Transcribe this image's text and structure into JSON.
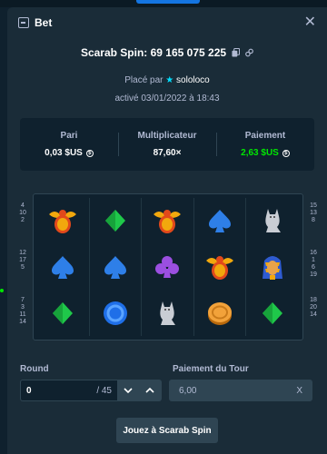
{
  "header": {
    "title": "Bet",
    "close_icon": "close-icon"
  },
  "game": {
    "title": "Scarab Spin: 69 165 075 225",
    "placed_prefix": "Placé par",
    "username": "sololoco",
    "date": "activé 03/01/2022 à 18:43"
  },
  "stats": {
    "bet_label": "Pari",
    "bet_value": "0,03 $US",
    "multiplier_label": "Multiplicateur",
    "multiplier_value": "87,60×",
    "payout_label": "Paiement",
    "payout_value": "2,63 $US"
  },
  "board": {
    "paylines_left": [
      [
        "4",
        "10",
        "2"
      ],
      [
        "12",
        "17",
        "5"
      ],
      [
        "7",
        "3",
        "11",
        "14"
      ]
    ],
    "paylines_right": [
      [
        "15",
        "13",
        "8"
      ],
      [
        "16",
        "1",
        "6",
        "19"
      ],
      [
        "18",
        "20",
        "14"
      ]
    ],
    "grid": [
      [
        "scarab",
        "diamond-green",
        "scarab",
        "spade-blue",
        "cat-statue"
      ],
      [
        "spade-blue",
        "spade-blue",
        "club-purple",
        "scarab",
        "pharaoh"
      ],
      [
        "diamond-green",
        "ring-blue",
        "cat-statue",
        "coin-gold",
        "diamond-green"
      ]
    ]
  },
  "controls": {
    "round_label": "Round",
    "round_value": "0",
    "round_total": "/ 45",
    "payout_label": "Paiement du Tour",
    "payout_value": "6,00",
    "payout_suffix": "X",
    "play_label": "Jouez à Scarab Spin"
  },
  "colors": {
    "accent_green": "#00e701",
    "bg": "#0f212e",
    "panel": "#1a2c38",
    "muted": "#b1bad3"
  }
}
